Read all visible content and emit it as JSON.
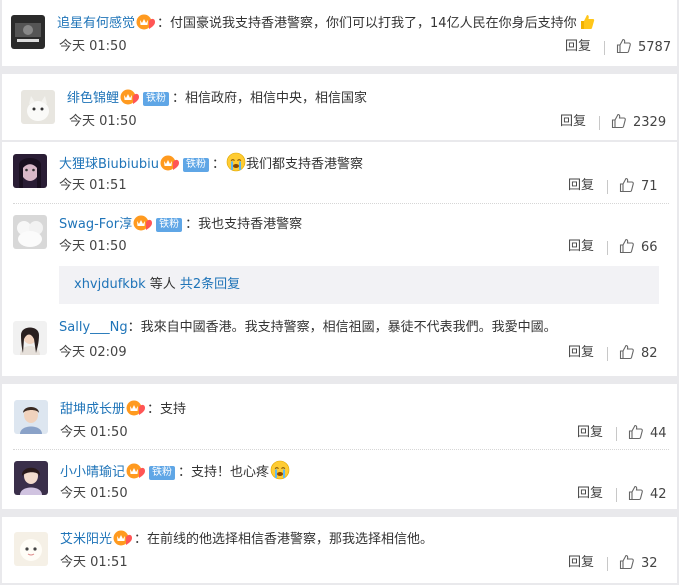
{
  "reply_label": "回复",
  "colors": {
    "username": "#1f74b8",
    "fan_badge": "#5fa6e6",
    "background": "#e9e9ec"
  },
  "comments": [
    {
      "user": "追星有何感觉",
      "fan_badge": "",
      "text": "付国豪说我支持香港警察，你们可以打我了，14亿人民在你身后支持你",
      "emoji": "thumbs-up-emoji",
      "time": "今天 01:50",
      "likes": "5787"
    },
    {
      "user": "绯色锦鲤",
      "fan_badge": "铁粉",
      "text": "相信政府，相信中央，相信国家",
      "emoji": "",
      "time": "今天 01:50",
      "likes": "2329"
    },
    {
      "user": "大狸球Biubiubiu",
      "fan_badge": "铁粉",
      "text": "我们都支持香港警察",
      "emoji": "crying-face-emoji",
      "time": "今天 01:51",
      "likes": "71"
    },
    {
      "user": "Swag-For淳",
      "fan_badge": "铁粉",
      "text": "我也支持香港警察",
      "emoji": "",
      "time": "今天 01:50",
      "likes": "66",
      "sub_replies": {
        "names": "xhvjdufkbk",
        "middle": " 等人 ",
        "more": "共2条回复"
      }
    },
    {
      "user": "Sally___Ng",
      "fan_badge": "",
      "text": "我來自中國香港。我支持警察，相信祖國，暴徒不代表我們。我愛中國。",
      "emoji": "",
      "time": "今天 02:09",
      "likes": "82"
    },
    {
      "user": "甜坤成长册",
      "fan_badge": "",
      "text": "支持",
      "emoji": "",
      "time": "今天 01:50",
      "likes": "44"
    },
    {
      "user": "小小晴瑜记",
      "fan_badge": "铁粉",
      "text": "支持！也心疼",
      "emoji": "crying-face-emoji",
      "time": "今天 01:50",
      "likes": "42"
    },
    {
      "user": "艾米阳光",
      "fan_badge": "",
      "text": "在前线的他选择相信香港警察，那我选择相信他。",
      "emoji": "",
      "time": "今天 01:51",
      "likes": "32"
    }
  ]
}
